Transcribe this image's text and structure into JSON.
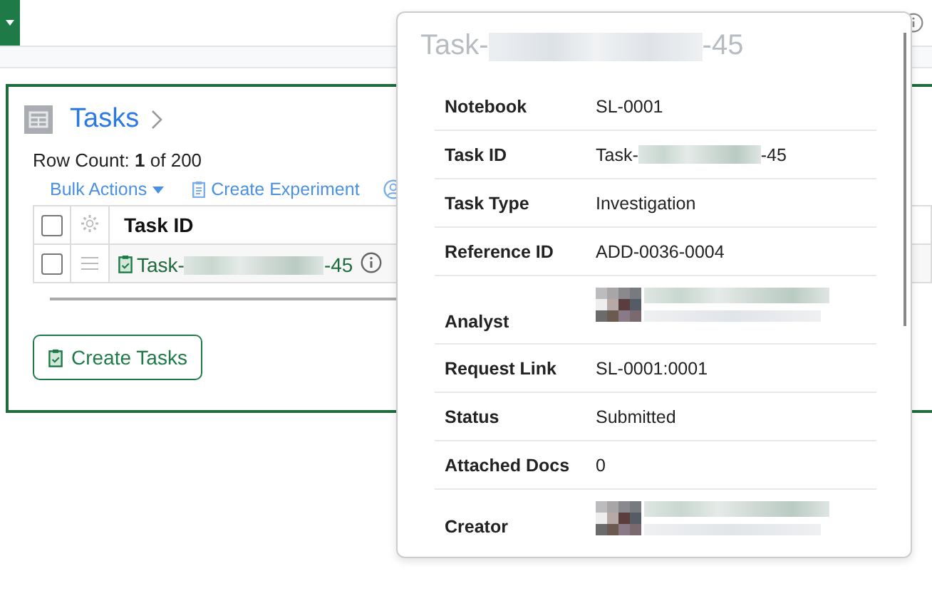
{
  "panel": {
    "title": "Tasks",
    "row_count": "Row Count: **1** of 200"
  },
  "toolbar": [
    {
      "label": "Bulk Actions",
      "kind": "dropdown"
    },
    {
      "label": "Create Experiment",
      "kind": "action"
    },
    {
      "kind": "user"
    }
  ],
  "table": {
    "header_checked": false,
    "columns": [
      "Task ID"
    ],
    "rows": [
      {
        "checked": false,
        "task_id_start": "Task-",
        "task_id_end": "-45"
      }
    ]
  },
  "create_button": "Create Tasks",
  "popover": {
    "title_start": "Task-",
    "title_end": "-45",
    "fields": [
      {
        "label": "Notebook",
        "kind": "text",
        "value": "SL-0001"
      },
      {
        "label": "Task ID",
        "kind": "redacted",
        "value_start": "Task-",
        "value_end": "-45"
      },
      {
        "label": "Task Type",
        "kind": "text",
        "value": "Investigation"
      },
      {
        "label": "Reference ID",
        "kind": "text",
        "value": "ADD-0036-0004"
      },
      {
        "label": "Analyst",
        "kind": "person"
      },
      {
        "label": "Request Link",
        "kind": "text",
        "value": "SL-0001:0001"
      },
      {
        "label": "Status",
        "kind": "text",
        "value": "Submitted"
      },
      {
        "label": "Attached Docs",
        "kind": "text",
        "value": "0"
      },
      {
        "label": "Creator",
        "kind": "person"
      }
    ]
  }
}
